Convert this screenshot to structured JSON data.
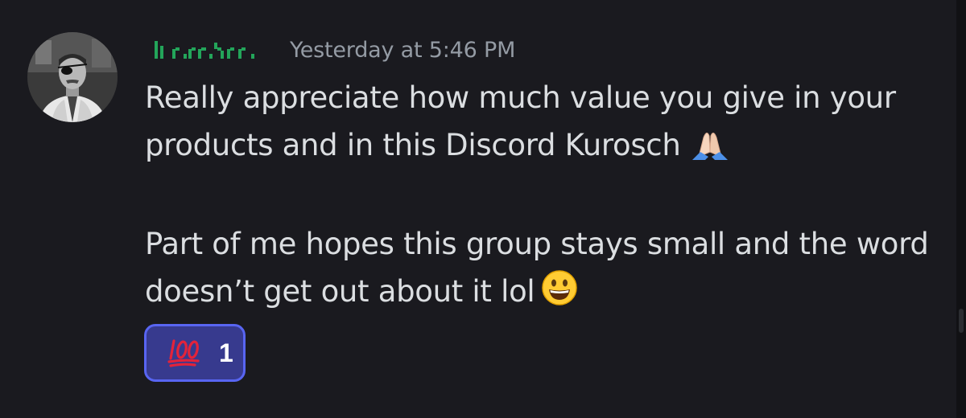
{
  "message": {
    "author": {
      "username": "lı r rı.)ı r r",
      "name_color": "#23a55a",
      "avatar": "avatar-photo"
    },
    "timestamp": "Yesterday at 5:46 PM",
    "paragraphs": [
      "Really appreciate how much value you give in your products and in this Discord Kurosch",
      "Part of me hopes this group stays small and the word doesn’t get out about it lol"
    ],
    "emojis": [
      "folded-hands-icon",
      "grinning-face-icon"
    ],
    "reactions": [
      {
        "emoji": "hundred-points-icon",
        "count": "1",
        "active": true
      }
    ]
  },
  "colors": {
    "background": "#1a1a1f",
    "text": "#dbdee1",
    "timestamp": "#949ba4",
    "reaction_bg": "#373a8e",
    "reaction_border": "#5865f2"
  }
}
